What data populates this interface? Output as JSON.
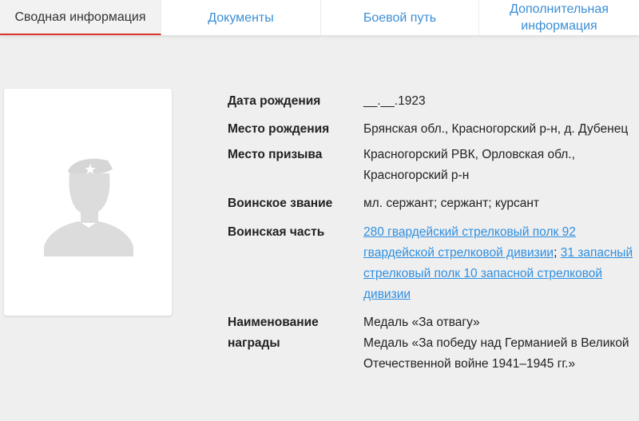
{
  "tabs": [
    {
      "label": "Сводная информация",
      "active": true
    },
    {
      "label": "Документы",
      "active": false
    },
    {
      "label": "Боевой путь",
      "active": false
    },
    {
      "label": "Дополнительная информация",
      "active": false
    }
  ],
  "avatar": {
    "icon": "soldier-silhouette-icon"
  },
  "info": {
    "birth_date": {
      "label": "Дата рождения",
      "value": "__.__.1923"
    },
    "birth_place": {
      "label": "Место рождения",
      "value": "Брянская обл., Красногорский р-н, д. Дубенец"
    },
    "conscription_place": {
      "label": "Место призыва",
      "value": "Красногорский РВК, Орловская обл., Красногорский р-н"
    },
    "rank": {
      "label": "Воинское звание",
      "value": "мл. сержант; сержант; курсант"
    },
    "unit": {
      "label": "Воинская часть",
      "link1": "280 гвардейский стрелковый полк 92 гвардейской стрелковой дивизии",
      "separator": "; ",
      "link2": "31 запасный стрелковый полк 10 запасной стрелковой дивизии"
    },
    "awards": {
      "label": "Наименование награды",
      "items": [
        "Медаль «За отвагу»",
        "Медаль «За победу над Германией в Великой Отечественной войне 1941–1945 гг.»"
      ]
    }
  },
  "colors": {
    "accent": "#d9342b",
    "link": "#2f8fe0",
    "background": "#efefef"
  }
}
